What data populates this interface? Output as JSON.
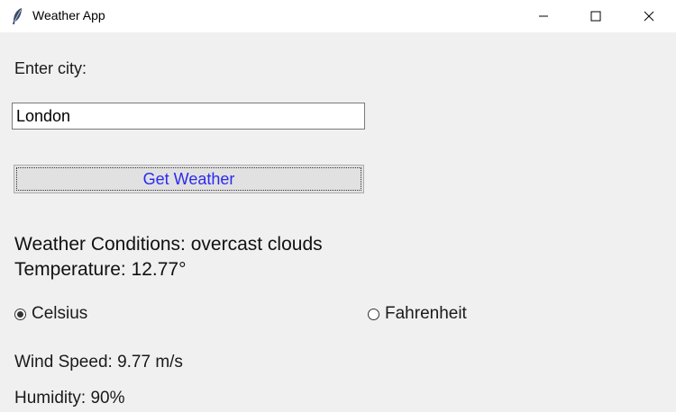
{
  "window": {
    "title": "Weather App",
    "icon": "feather-icon"
  },
  "form": {
    "city_label": "Enter city:",
    "city_value": "London",
    "get_weather_label": "Get Weather"
  },
  "results": {
    "conditions": "Weather Conditions: overcast clouds",
    "temperature": "Temperature: 12.77°",
    "wind_speed": "Wind Speed: 9.77 m/s",
    "humidity": "Humidity: 90%"
  },
  "units": {
    "celsius_label": "Celsius",
    "fahrenheit_label": "Fahrenheit",
    "selected": "Celsius"
  },
  "colors": {
    "button_text": "#2a2aef",
    "window_bg": "#f0f0f0",
    "titlebar_bg": "#ffffff"
  }
}
